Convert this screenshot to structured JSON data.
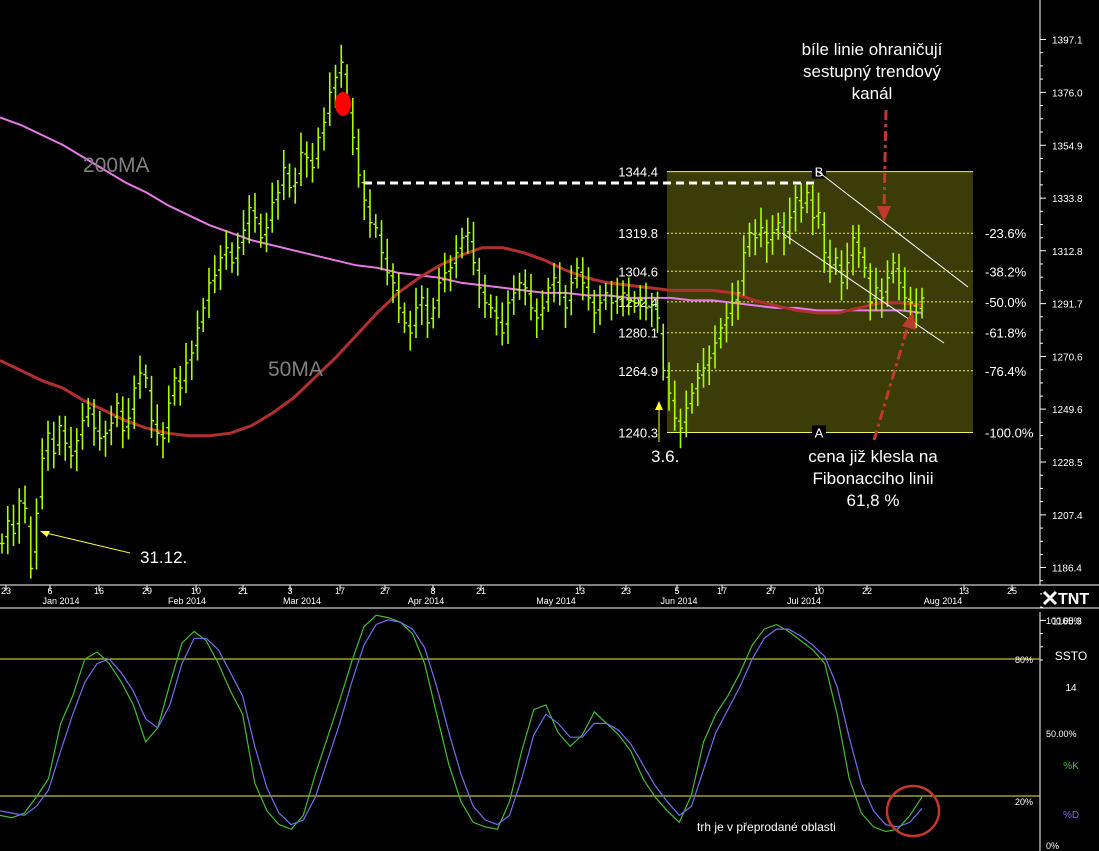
{
  "chart_data": [
    {
      "type": "bar",
      "subtype": "ohlc-price-chart",
      "y_ticks": [
        "1397.1",
        "1376.0",
        "1354.9",
        "1333.8",
        "1312.8",
        "1291.7",
        "1270.6",
        "1249.6",
        "1228.5",
        "1207.4",
        "1186.4",
        "1165.3"
      ],
      "ylim": [
        1155,
        1410
      ],
      "x_day_ticks": [
        "23",
        "6",
        "16",
        "29",
        "10",
        "21",
        "3",
        "17",
        "27",
        "8",
        "21",
        "13",
        "23",
        "5",
        "17",
        "27",
        "10",
        "22",
        "13",
        "25"
      ],
      "x_month_ticks": [
        "Jan 2014",
        "Feb 2014",
        "Mar 2014",
        "Apr 2014",
        "May 2014",
        "Jun 2014",
        "Jul 2014",
        "Aug 2014"
      ],
      "bars_close_estimate": [
        1196,
        1205,
        1200,
        1213,
        1210,
        1186,
        1208,
        1230,
        1240,
        1232,
        1243,
        1236,
        1231,
        1237,
        1245,
        1250,
        1242,
        1238,
        1240,
        1244,
        1252,
        1241,
        1246,
        1258,
        1264,
        1262,
        1245,
        1240,
        1238,
        1252,
        1262,
        1258,
        1268,
        1272,
        1282,
        1290,
        1300,
        1303,
        1310,
        1314,
        1308,
        1314,
        1321,
        1330,
        1326,
        1318,
        1322,
        1332,
        1336,
        1346,
        1338,
        1340,
        1352,
        1350,
        1346,
        1358,
        1364,
        1376,
        1382,
        1388,
        1372,
        1358,
        1343,
        1333,
        1324,
        1322,
        1312,
        1304,
        1300,
        1290,
        1284,
        1280,
        1290,
        1294,
        1284,
        1290,
        1300,
        1304,
        1306,
        1312,
        1318,
        1320,
        1308,
        1298,
        1292,
        1290,
        1286,
        1280,
        1292,
        1296,
        1300,
        1298,
        1290,
        1286,
        1290,
        1298,
        1302,
        1296,
        1290,
        1300,
        1306,
        1300,
        1294,
        1288,
        1292,
        1296,
        1292,
        1294,
        1296,
        1293,
        1292,
        1293,
        1290,
        1291,
        1286,
        1265,
        1256,
        1246,
        1242,
        1250,
        1256,
        1262,
        1266,
        1270,
        1276,
        1282,
        1286,
        1292,
        1296,
        1312,
        1320,
        1318,
        1322,
        1316,
        1320,
        1324,
        1318,
        1326,
        1334,
        1330,
        1336,
        1326,
        1328,
        1312,
        1306,
        1310,
        1300,
        1308,
        1318,
        1312,
        1306,
        1292,
        1298,
        1294,
        1302,
        1308,
        1300,
        1294,
        1292,
        1288,
        1294
      ],
      "series": [
        {
          "name": "200MA",
          "color": "#e67ae6",
          "values_estimate": [
            1366,
            1363,
            1359,
            1355,
            1350,
            1345,
            1340,
            1336,
            1331,
            1327,
            1323,
            1320,
            1317,
            1315,
            1313,
            1311,
            1309,
            1307,
            1306,
            1304,
            1303,
            1302,
            1300,
            1299,
            1298,
            1297,
            1296,
            1296,
            1295,
            1295,
            1294,
            1294,
            1294,
            1293,
            1293,
            1292,
            1291,
            1290,
            1290,
            1289,
            1289,
            1289,
            1289,
            1289,
            1288
          ]
        },
        {
          "name": "50MA",
          "color": "#b03030",
          "values_estimate": [
            1269,
            1265,
            1261,
            1258,
            1253,
            1249,
            1245,
            1242,
            1240,
            1239,
            1239,
            1240,
            1243,
            1248,
            1254,
            1262,
            1270,
            1279,
            1288,
            1296,
            1302,
            1307,
            1311,
            1314,
            1314,
            1312,
            1309,
            1305,
            1302,
            1300,
            1299,
            1298,
            1297,
            1297,
            1297,
            1296,
            1293,
            1291,
            1289,
            1288,
            1288,
            1290,
            1292,
            1292,
            1291
          ]
        }
      ],
      "fibonacci": {
        "levels": [
          {
            "price": "1344.4",
            "pct": ""
          },
          {
            "price": "1319.8",
            "pct": "-23.6%"
          },
          {
            "price": "1304.6",
            "pct": "-38.2%"
          },
          {
            "price": "1292.4",
            "pct": "-50.0%"
          },
          {
            "price": "1280.1",
            "pct": "-61.8%"
          },
          {
            "price": "1264.9",
            "pct": "-76.4%"
          },
          {
            "price": "1240.3",
            "pct": "-100.0%"
          }
        ],
        "point_b": "B",
        "point_a": "A"
      },
      "annotations": {
        "ma200_label": "200MA",
        "ma50_label": "50MA",
        "date_low_jan": "31.12.",
        "date_low_jun": "3.6.",
        "channel_note_1": "bíle linie ohraničují",
        "channel_note_2": "sestupný trendový",
        "channel_note_3": "kanál",
        "fib_note_1": "cena již klesla na",
        "fib_note_2": "Fibonacciho linii",
        "fib_note_3": "61,8 %"
      },
      "colors": {
        "bars": "#aaff00",
        "fib_box": "#3c3c08",
        "fib_lines": "#f0f060",
        "arrows": "#c0392b"
      }
    },
    {
      "type": "line",
      "subtype": "stochastic-oscillator",
      "title": "SSTO",
      "period": "14",
      "k_label": "%K",
      "d_label": "%D",
      "y_ticks": [
        "100.00%",
        "50.00%",
        "0%"
      ],
      "levels": [
        "80%",
        "20%"
      ],
      "ylim": [
        0,
        100
      ],
      "note": "trh je v přeprodané oblasti",
      "series": [
        {
          "name": "%K",
          "color": "#44bb33",
          "values_estimate": [
            12,
            11,
            13,
            20,
            28,
            52,
            64,
            80,
            83,
            78,
            70,
            60,
            44,
            50,
            69,
            87,
            92,
            88,
            78,
            66,
            56,
            26,
            14,
            8,
            6,
            12,
            30,
            46,
            62,
            79,
            94,
            99,
            98,
            96,
            91,
            78,
            56,
            34,
            18,
            9,
            7,
            6,
            18,
            40,
            58,
            60,
            48,
            42,
            47,
            57,
            52,
            47,
            40,
            28,
            20,
            14,
            9,
            21,
            44,
            56,
            64,
            74,
            86,
            93,
            95,
            92,
            88,
            84,
            78,
            56,
            28,
            13,
            7,
            5,
            6,
            12,
            20
          ]
        },
        {
          "name": "%D",
          "color": "#7070ee",
          "values_estimate": [
            14,
            13,
            12,
            16,
            23,
            40,
            56,
            70,
            78,
            80,
            74,
            66,
            54,
            50,
            60,
            78,
            89,
            89,
            84,
            74,
            64,
            42,
            24,
            13,
            8,
            10,
            20,
            36,
            52,
            70,
            86,
            95,
            97,
            96,
            93,
            85,
            68,
            48,
            30,
            16,
            10,
            8,
            12,
            28,
            47,
            56,
            52,
            46,
            46,
            52,
            52,
            49,
            43,
            34,
            25,
            18,
            12,
            16,
            32,
            48,
            58,
            68,
            80,
            89,
            93,
            93,
            90,
            86,
            81,
            68,
            46,
            26,
            14,
            8,
            7,
            9,
            15
          ]
        }
      ]
    }
  ],
  "branding": {
    "logo_text": "TNT"
  }
}
